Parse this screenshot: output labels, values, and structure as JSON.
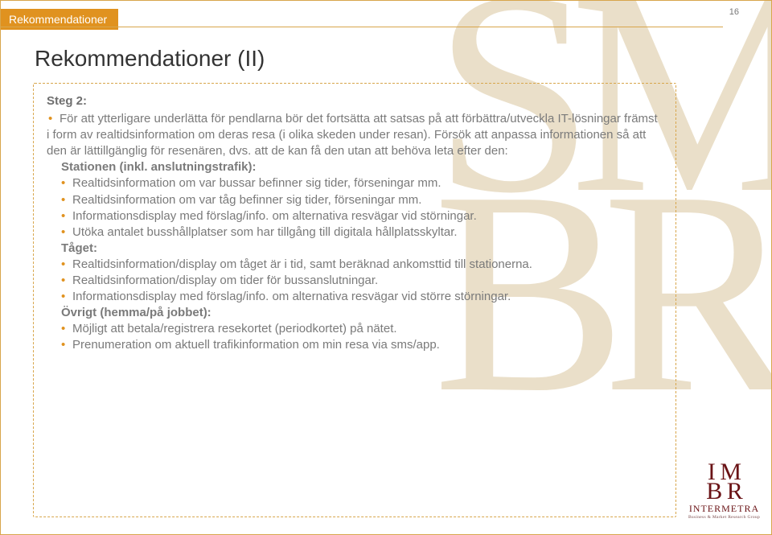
{
  "page_number": "16",
  "tab_label": "Rekommendationer",
  "title": "Rekommendationer (II)",
  "step_label": "Steg 2:",
  "intro": "För att ytterligare underlätta för pendlarna bör det fortsätta att satsas på att förbättra/utveckla IT-lösningar främst i form av realtidsinformation om deras resa (i olika skeden under resan). Försök att anpassa informationen så att den är lättillgänglig för resenären, dvs. att de kan få den utan att behöva leta efter den:",
  "sections": {
    "station": {
      "heading": "Stationen (inkl. anslutningstrafik):",
      "items": [
        "Realtidsinformation om var bussar befinner sig tider, förseningar mm.",
        "Realtidsinformation om var tåg befinner sig tider, förseningar mm.",
        "Informationsdisplay med förslag/info. om alternativa resvägar vid störningar.",
        "Utöka antalet busshållplatser som har tillgång till digitala hållplatsskyltar."
      ]
    },
    "train": {
      "heading": "Tåget:",
      "items": [
        "Realtidsinformation/display om tåget är i tid, samt beräknad ankomsttid till stationerna.",
        "Realtidsinformation/display om tider för bussanslutningar.",
        "Informationsdisplay med förslag/info. om alternativa resvägar vid större störningar."
      ]
    },
    "other": {
      "heading": "Övrigt (hemma/på jobbet):",
      "items": [
        "Möjligt att betala/registrera resekortet (periodkortet) på nätet.",
        "Prenumeration om aktuell trafikinformation om min resa via sms/app."
      ]
    }
  },
  "logo": {
    "mark_top": "I  M",
    "mark_bottom": "B R",
    "name": "INTERMETRA",
    "tagline": "Business & Market Research Group"
  }
}
